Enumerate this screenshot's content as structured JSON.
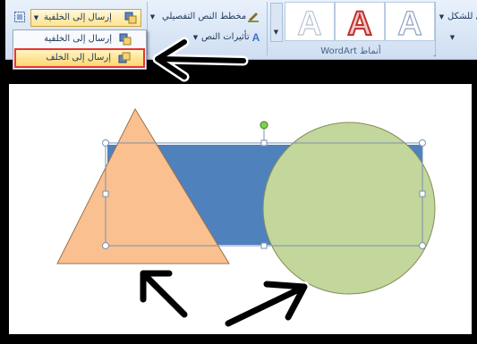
{
  "ribbon": {
    "bring_forward_label": "إرسال إلى الخلفية",
    "text_fill_label": "مخطط النص التفصيلي",
    "text_effects_label": "تأثيرات النص",
    "shape_right_label": "ي للشكل",
    "wordart_group_label": "أنماط WordArt",
    "wordart_letters": [
      "A",
      "A",
      "A"
    ]
  },
  "menu": {
    "items": [
      {
        "label": "إرسال إلى الخلفية",
        "icon": "send-to-back-icon"
      },
      {
        "label": "إرسال إلى الخلف",
        "icon": "send-backward-icon"
      }
    ]
  },
  "colors": {
    "rectangle": "#4f81bd",
    "triangle": "#fac090",
    "circle": "#c3d69b",
    "highlight_border": "#e53535",
    "arrows": "#000000"
  }
}
